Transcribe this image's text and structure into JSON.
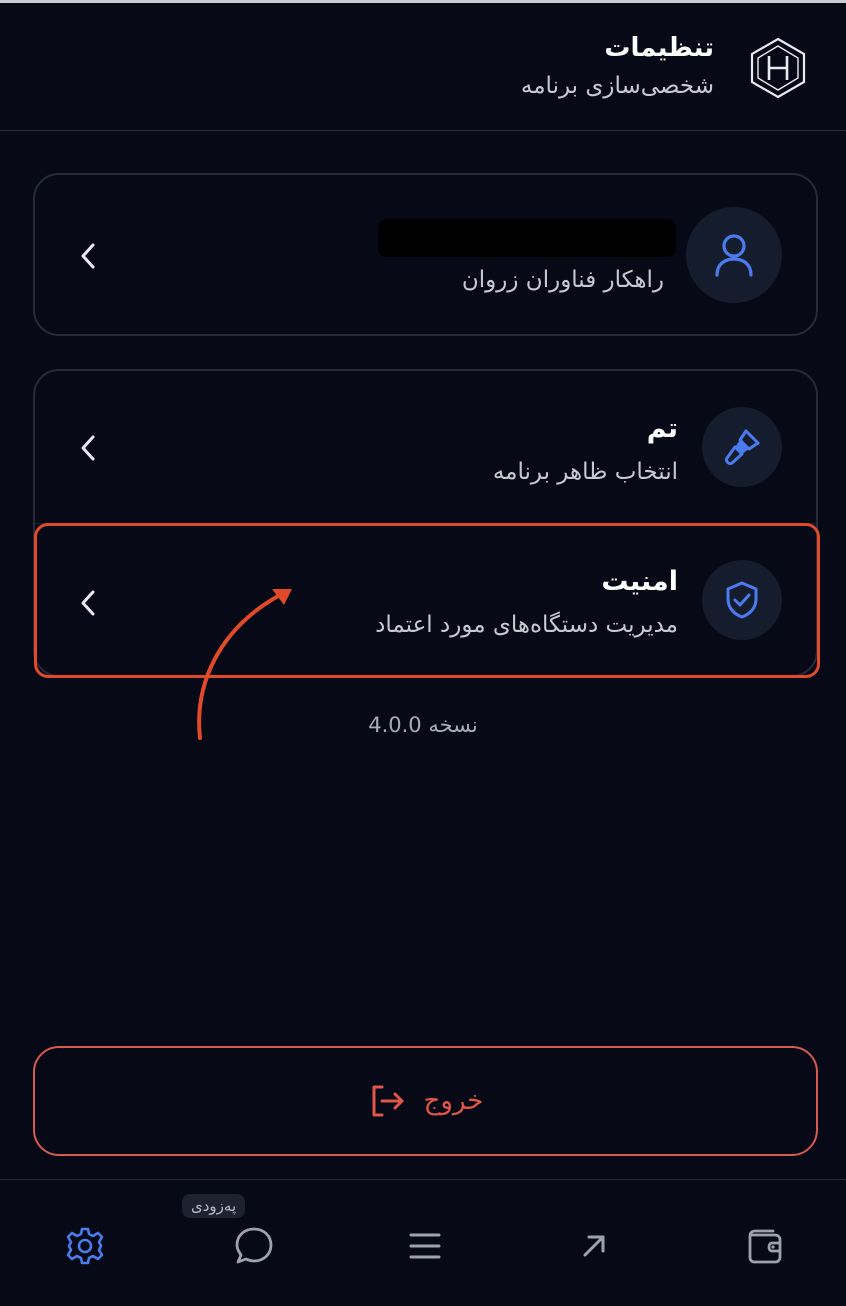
{
  "header": {
    "title": "تنظیمات",
    "subtitle": "شخصی‌سازی برنامه",
    "logo_icon": "hexagon-h-logo-icon"
  },
  "profile": {
    "name_redacted": "",
    "company": "راهکار فناوران زروان",
    "icon": "user-icon"
  },
  "settings": {
    "theme": {
      "title": "تم",
      "subtitle": "انتخاب ظاهر برنامه",
      "icon": "paintbrush-icon"
    },
    "security": {
      "title": "امنیت",
      "subtitle": "مدیریت دستگاه‌های مورد اعتماد",
      "icon": "shield-check-icon"
    }
  },
  "version": "نسخه 4.0.0",
  "logout": {
    "label": "خروج",
    "icon": "logout-icon"
  },
  "nav": {
    "chat_badge": "پەزودی",
    "items": [
      "settings-icon",
      "chat-icon",
      "menu-icon",
      "arrow-up-right-icon",
      "wallet-icon"
    ]
  },
  "colors": {
    "background": "#070a16",
    "accent": "#4a7cf0",
    "danger": "#e0574a",
    "highlight": "#e04a2b"
  }
}
